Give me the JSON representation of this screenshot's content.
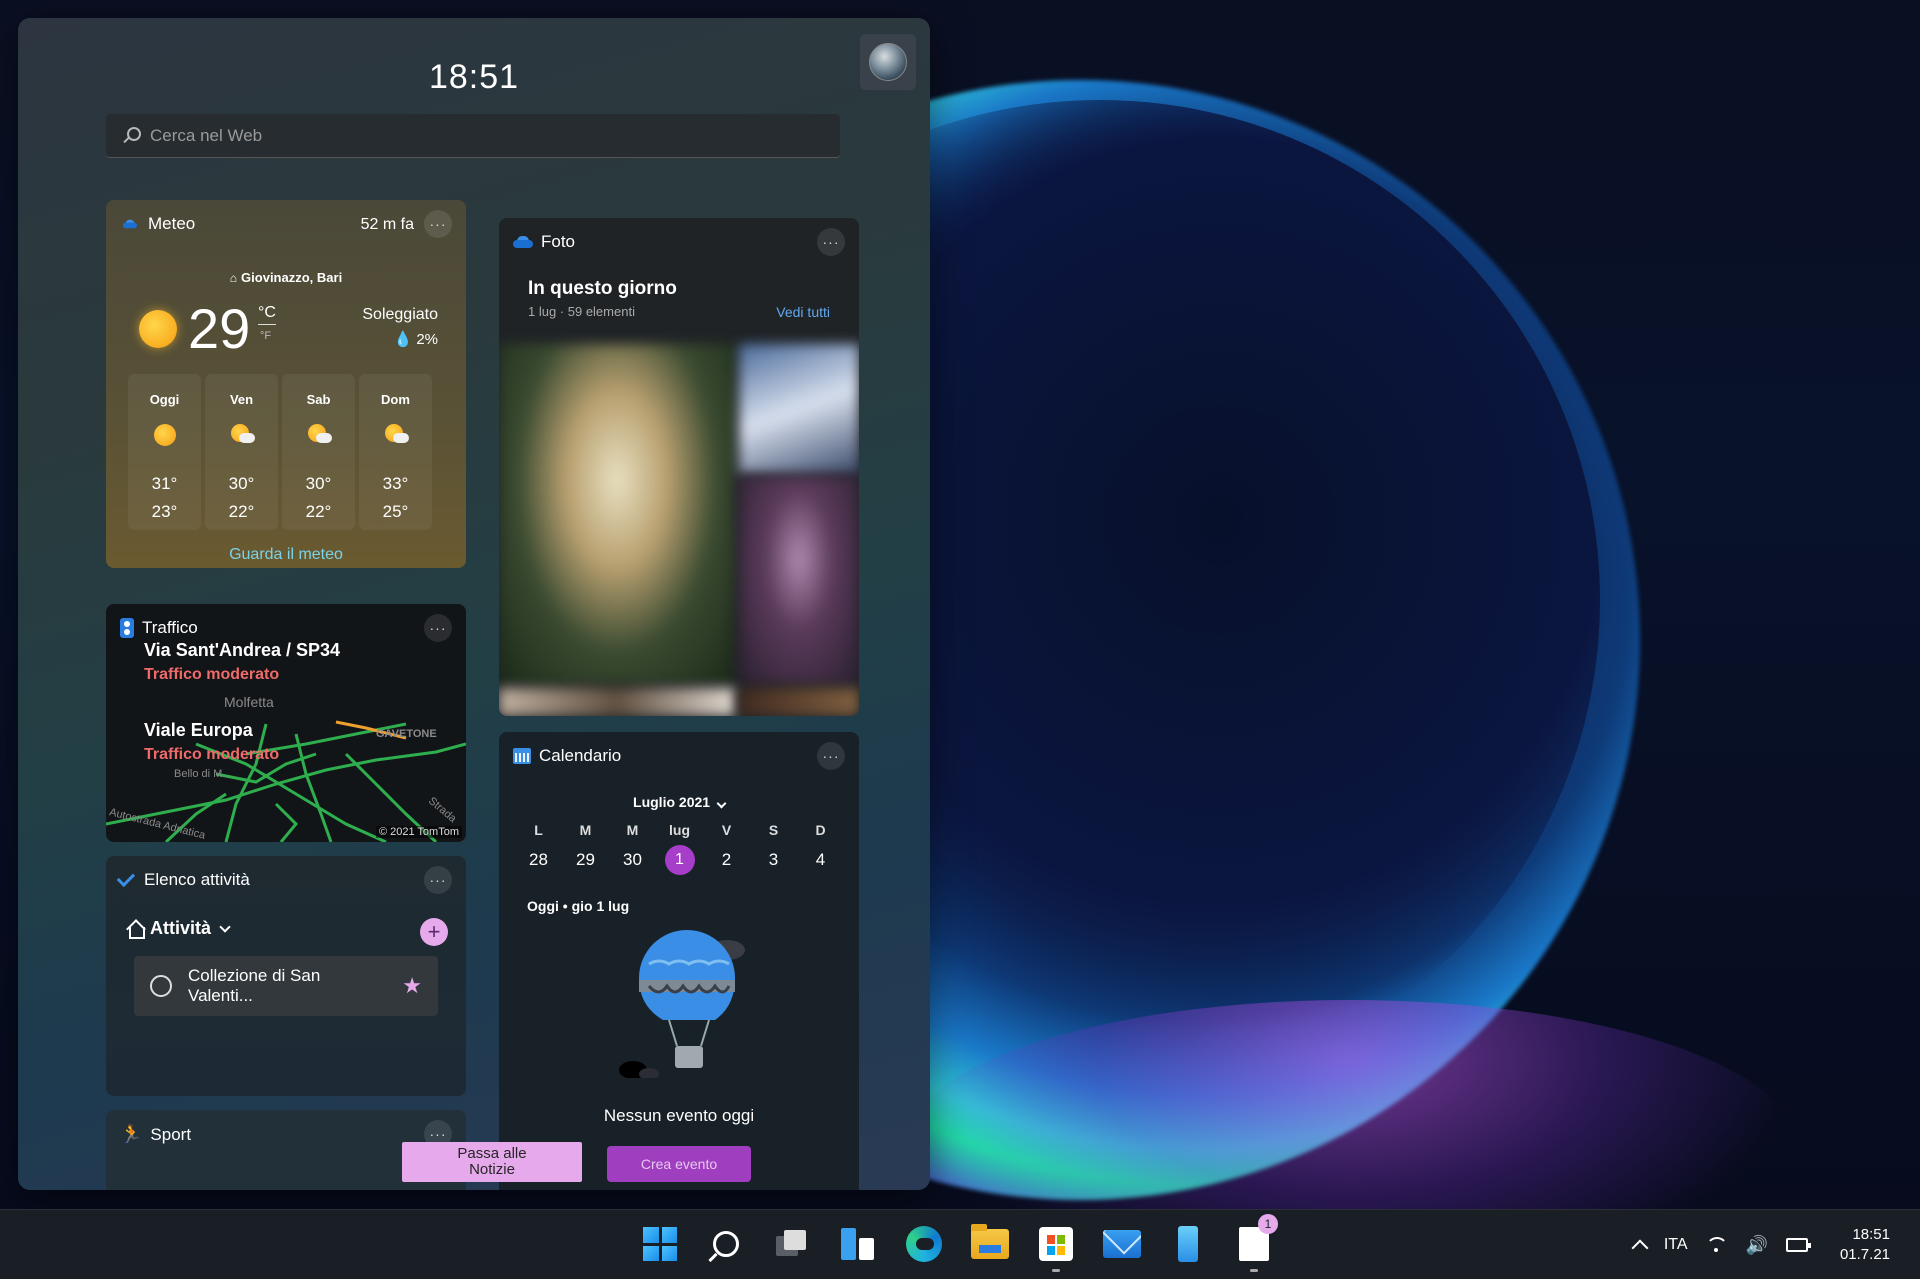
{
  "panel": {
    "time": "18:51",
    "search": {
      "placeholder": "Cerca nel Web"
    }
  },
  "weather": {
    "title": "Meteo",
    "updated": "52 m fa",
    "location": "Giovinazzo, Bari",
    "temperature": "29",
    "unit_c": "°C",
    "unit_f": "°F",
    "condition": "Soleggiato",
    "precip": "2%",
    "days": [
      {
        "name": "Oggi",
        "icon": "sun-icon",
        "high": "31°",
        "low": "23°"
      },
      {
        "name": "Ven",
        "icon": "partly-cloudy-icon",
        "high": "30°",
        "low": "22°"
      },
      {
        "name": "Sab",
        "icon": "partly-cloudy-icon",
        "high": "30°",
        "low": "22°"
      },
      {
        "name": "Dom",
        "icon": "partly-cloudy-icon",
        "high": "33°",
        "low": "25°"
      }
    ],
    "link": "Guarda il meteo"
  },
  "photos": {
    "title": "Foto",
    "heading": "In questo giorno",
    "subtitle": "1 lug · 59 elementi",
    "link": "Vedi tutti"
  },
  "traffic": {
    "title": "Traffico",
    "road1": "Via Sant'Andrea / SP34",
    "status1": "Traffico moderato",
    "road2": "Viale Europa",
    "status2": "Traffico moderato",
    "map_labels": [
      "Molfetta",
      "GAVETONE",
      "Bello di M...",
      "Autostrada Adriatica",
      "Strada"
    ],
    "copyright": "© 2021 TomTom"
  },
  "tasks": {
    "title": "Elenco attività",
    "list_name": "Attività",
    "items": [
      {
        "label": "Collezione di San Valenti..."
      }
    ]
  },
  "sport": {
    "title": "Sport"
  },
  "calendar": {
    "title": "Calendario",
    "month": "Luglio 2021",
    "weekdays": [
      "L",
      "M",
      "M",
      "lug",
      "V",
      "S",
      "D"
    ],
    "dates": [
      "28",
      "29",
      "30",
      "1",
      "2",
      "3",
      "4"
    ],
    "today_index": 3,
    "today_label": "Oggi • gio 1 lug",
    "empty": "Nessun evento oggi",
    "create_button": "Crea evento"
  },
  "news_button": {
    "line1": "Passa alle",
    "line2": "Notizie"
  },
  "taskbar": {
    "apps": [
      "start-icon",
      "search-icon",
      "task-view-icon",
      "widgets-icon",
      "edge-icon",
      "file-explorer-icon",
      "store-icon",
      "mail-icon",
      "phone-icon",
      "news-icon"
    ],
    "news_badge": "1",
    "language": "ITA",
    "time": "18:51",
    "date": "01.7.21"
  }
}
